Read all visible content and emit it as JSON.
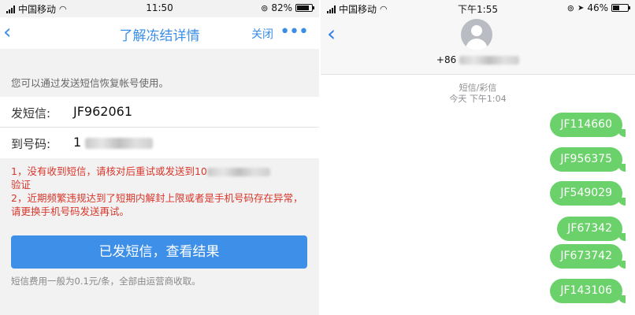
{
  "left_phone": {
    "status": {
      "carrier": "中国移动",
      "time": "11:50",
      "battery": "82%",
      "battery_level": 0.82
    },
    "nav": {
      "back": "‹",
      "title": "了解冻结详情",
      "close": "关闭",
      "more": "•••"
    },
    "hint": "您可以通过发送短信恢复帐号使用。",
    "form": {
      "sms_label": "发短信:",
      "sms_value": "JF962061",
      "to_label": "到号码:",
      "to_value_prefix": "1"
    },
    "warning": {
      "line1_prefix": "1，没有收到短信，请核对后重试或发送到10",
      "line1_suffix": "验证",
      "line2": "2，近期频繁违规达到了短期内解封上限或者是手机号码存在异常，请更换手机号码发送再试。"
    },
    "button": "已发短信，查看结果",
    "fee_note": "短信费用一般为0.1元/条，全部由运营商收取。"
  },
  "right_phone": {
    "status": {
      "carrier": "中国移动",
      "time": "下午1:55",
      "battery": "46%",
      "battery_level": 0.46
    },
    "back": "‹",
    "contact_prefix": "+86",
    "thread_type": "短信/彩信",
    "thread_time": "今天 下午1:04",
    "messages": [
      "JF114660",
      "JF956375",
      "JF549029",
      "JF67342",
      "JF673742",
      "JF143106"
    ]
  }
}
